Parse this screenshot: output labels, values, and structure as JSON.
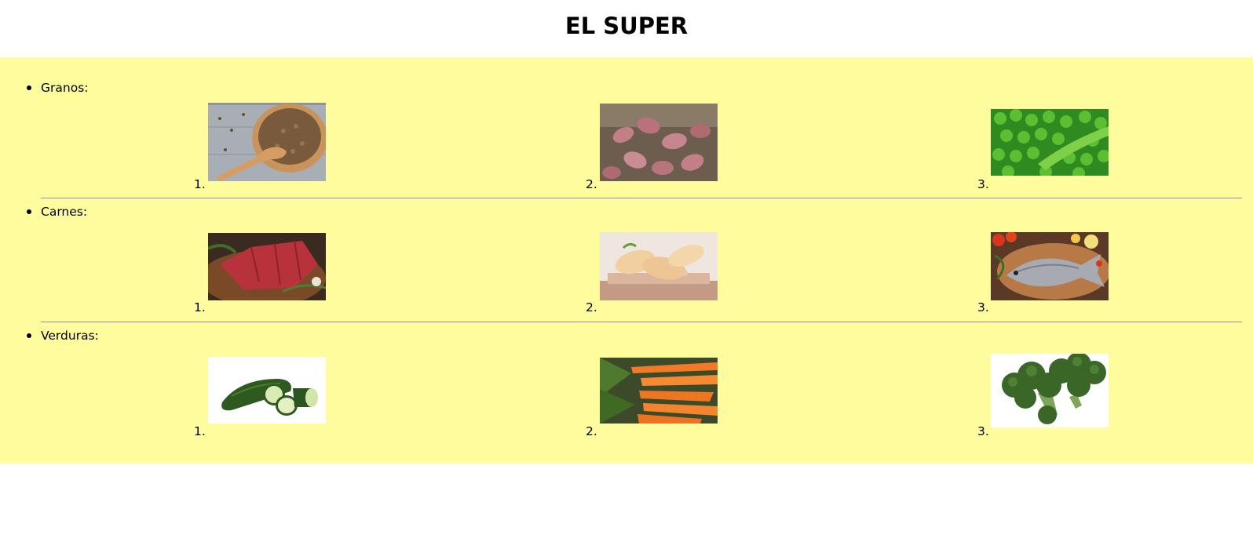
{
  "header": {
    "title": "EL SUPER"
  },
  "categories": [
    {
      "label": "Granos:",
      "items": [
        {
          "number": "1.",
          "icon": "lentils-bowl-image"
        },
        {
          "number": "2.",
          "icon": "kidney-beans-image"
        },
        {
          "number": "3.",
          "icon": "green-peas-image"
        }
      ]
    },
    {
      "label": "Carnes:",
      "items": [
        {
          "number": "1.",
          "icon": "raw-beef-image"
        },
        {
          "number": "2.",
          "icon": "chicken-drumsticks-image"
        },
        {
          "number": "3.",
          "icon": "fish-on-board-image"
        }
      ]
    },
    {
      "label": "Verduras:",
      "items": [
        {
          "number": "1.",
          "icon": "zucchini-image"
        },
        {
          "number": "2.",
          "icon": "carrots-image"
        },
        {
          "number": "3.",
          "icon": "broccoli-image"
        }
      ]
    }
  ],
  "colors": {
    "panel_background": "#fefc9c",
    "divider": "#8c8cbc"
  }
}
